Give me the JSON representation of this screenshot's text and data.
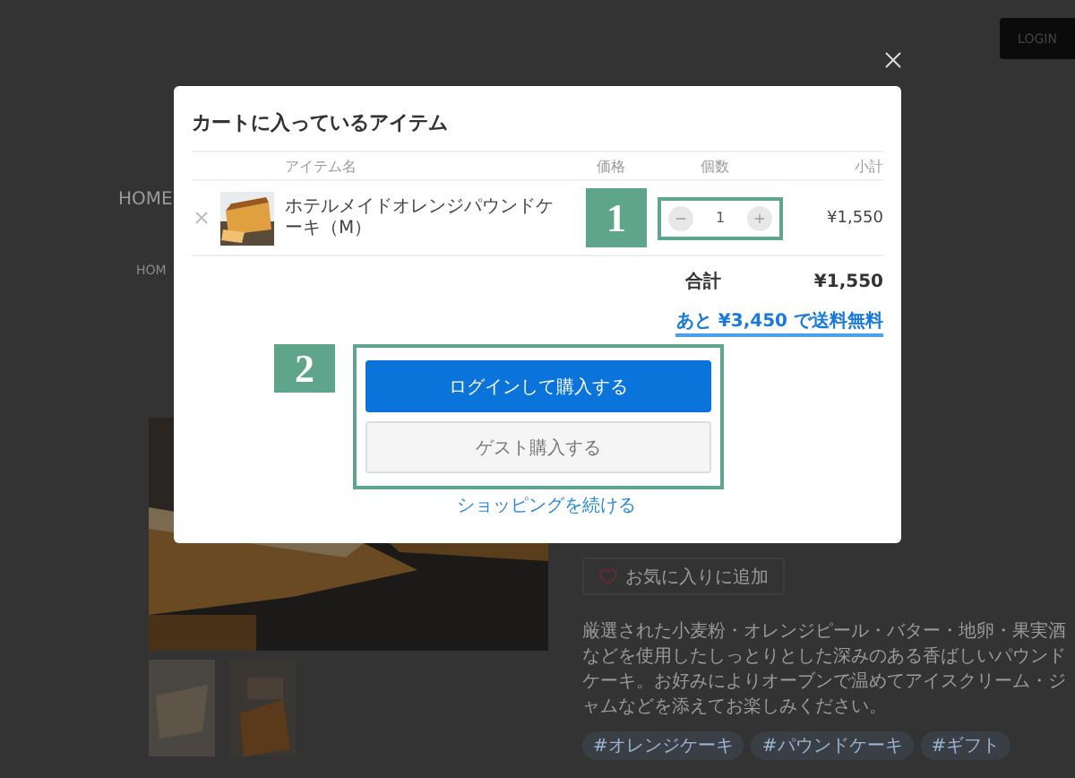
{
  "page": {
    "login": "LOGIN",
    "nav": "HOME",
    "breadcrumb": "HOM",
    "favorite": "お気に入りに追加",
    "description": "厳選された小麦粉・オレンジピール・バター・地卵・果実酒などを使用したしっとりとした深みのある香ばしいパウンドケーキ。お好みによりオーブンで温めてアイスクリーム・ジャムなどを添えてお楽しみください。",
    "tags": [
      "#オレンジケーキ",
      "#パウンドケーキ",
      "#ギフト"
    ]
  },
  "modal": {
    "title": "カートに入っているアイテム",
    "columns": [
      "アイテム名",
      "価格",
      "個数",
      "小計"
    ],
    "items": [
      {
        "name": "ホテルメイドオレンジパウンドケーキ（M）",
        "quantity": "1",
        "subtotal": "¥1,550"
      }
    ],
    "total_label": "合計",
    "total": "¥1,550",
    "shipping_note": "あと ¥3,450 で送料無料",
    "buttons": [
      {
        "label": "ログインして購入する",
        "kind": "primary"
      },
      {
        "label": "ゲスト購入する",
        "kind": "secondary"
      }
    ],
    "continue_link": "ショッピングを続ける"
  },
  "annotations": [
    "1",
    "2"
  ]
}
